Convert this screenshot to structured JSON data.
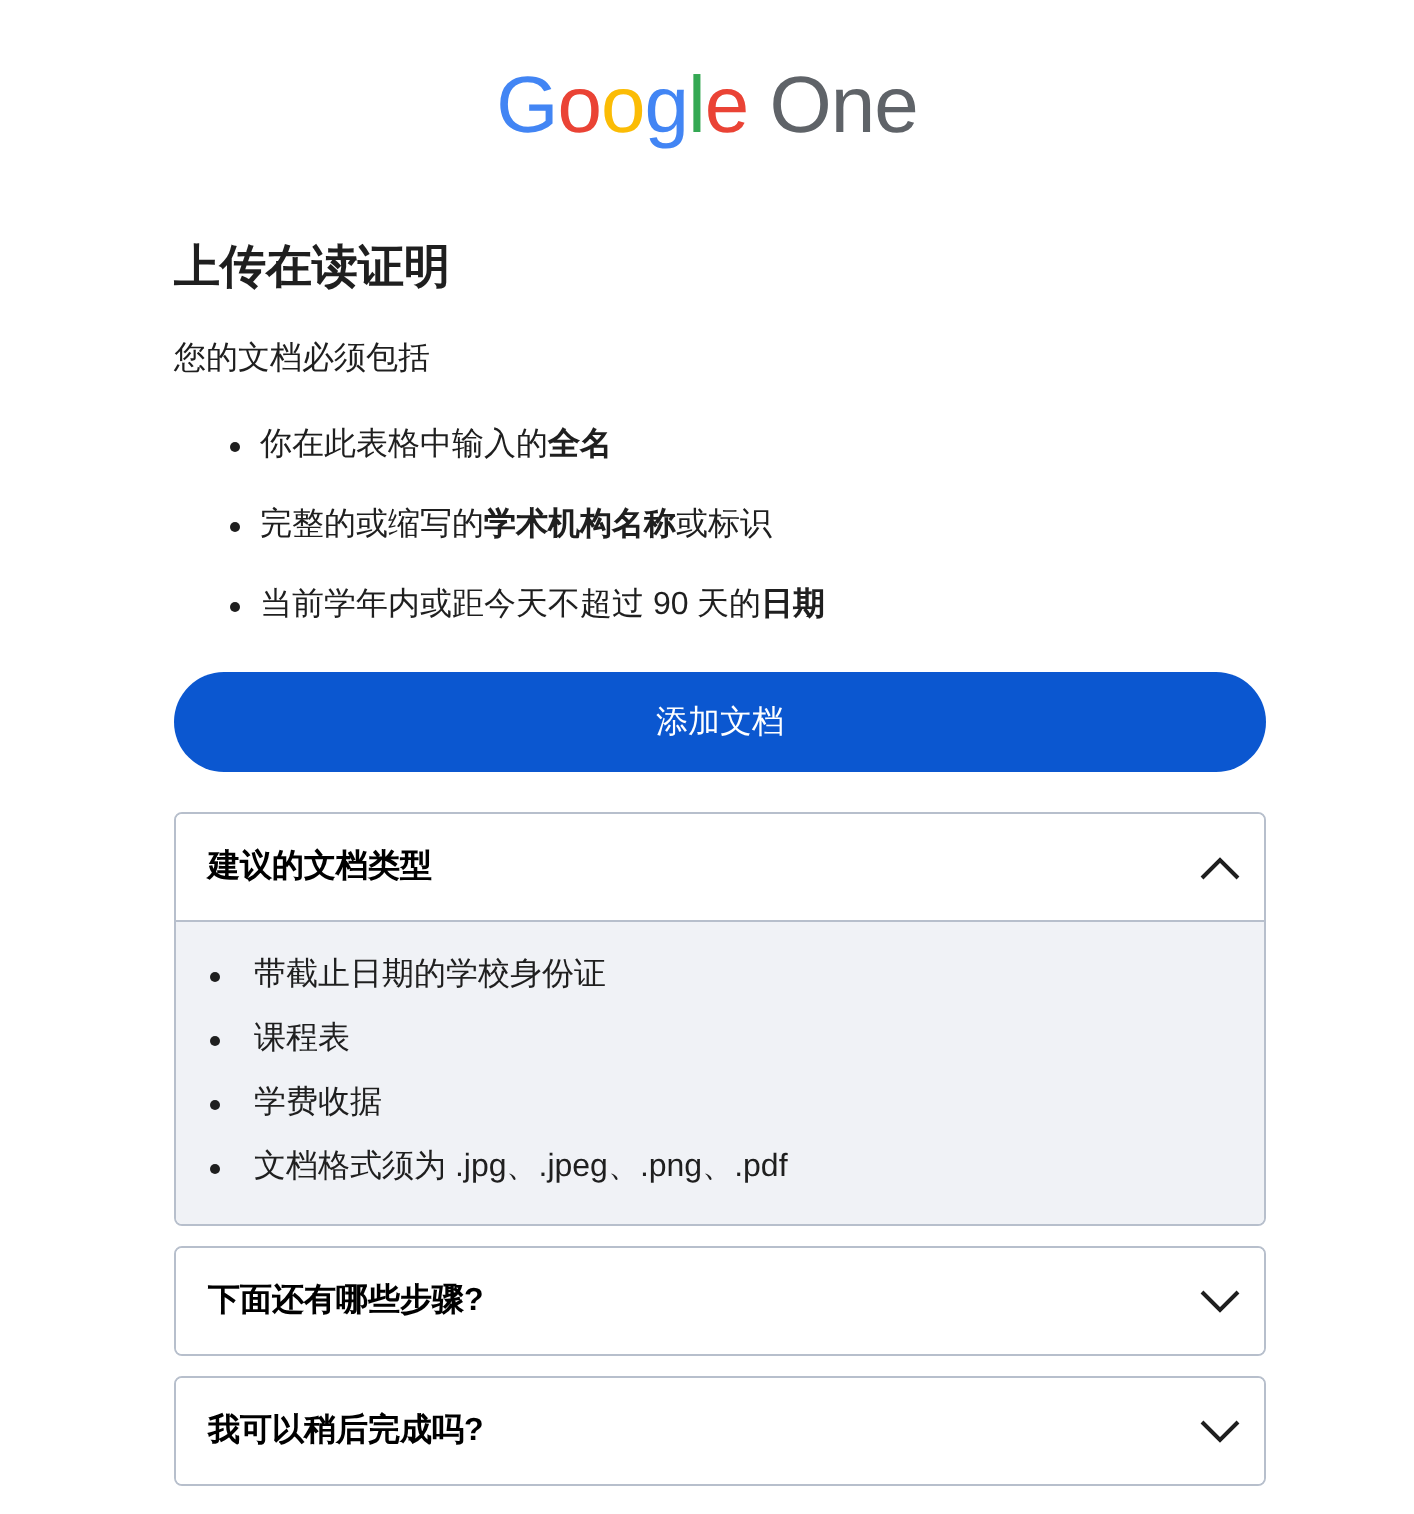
{
  "logo": {
    "brand": "Google",
    "product": "One"
  },
  "heading": "上传在读证明",
  "intro": "您的文档必须包括",
  "requirements": [
    "你在此表格中输入的**全名**",
    "完整的或缩写的**学术机构名称**或标识",
    "当前学年内或距今天不超过 90 天的**日期**"
  ],
  "add_button": "添加文档",
  "faq": [
    {
      "title": "建议的文档类型",
      "expanded": true,
      "items": [
        "带截止日期的学校身份证",
        "课程表",
        "学费收据",
        "文档格式须为 .jpg、.jpeg、.png、.pdf"
      ]
    },
    {
      "title": "下面还有哪些步骤?",
      "expanded": false
    },
    {
      "title": "我可以稍后完成吗?",
      "expanded": false
    }
  ]
}
